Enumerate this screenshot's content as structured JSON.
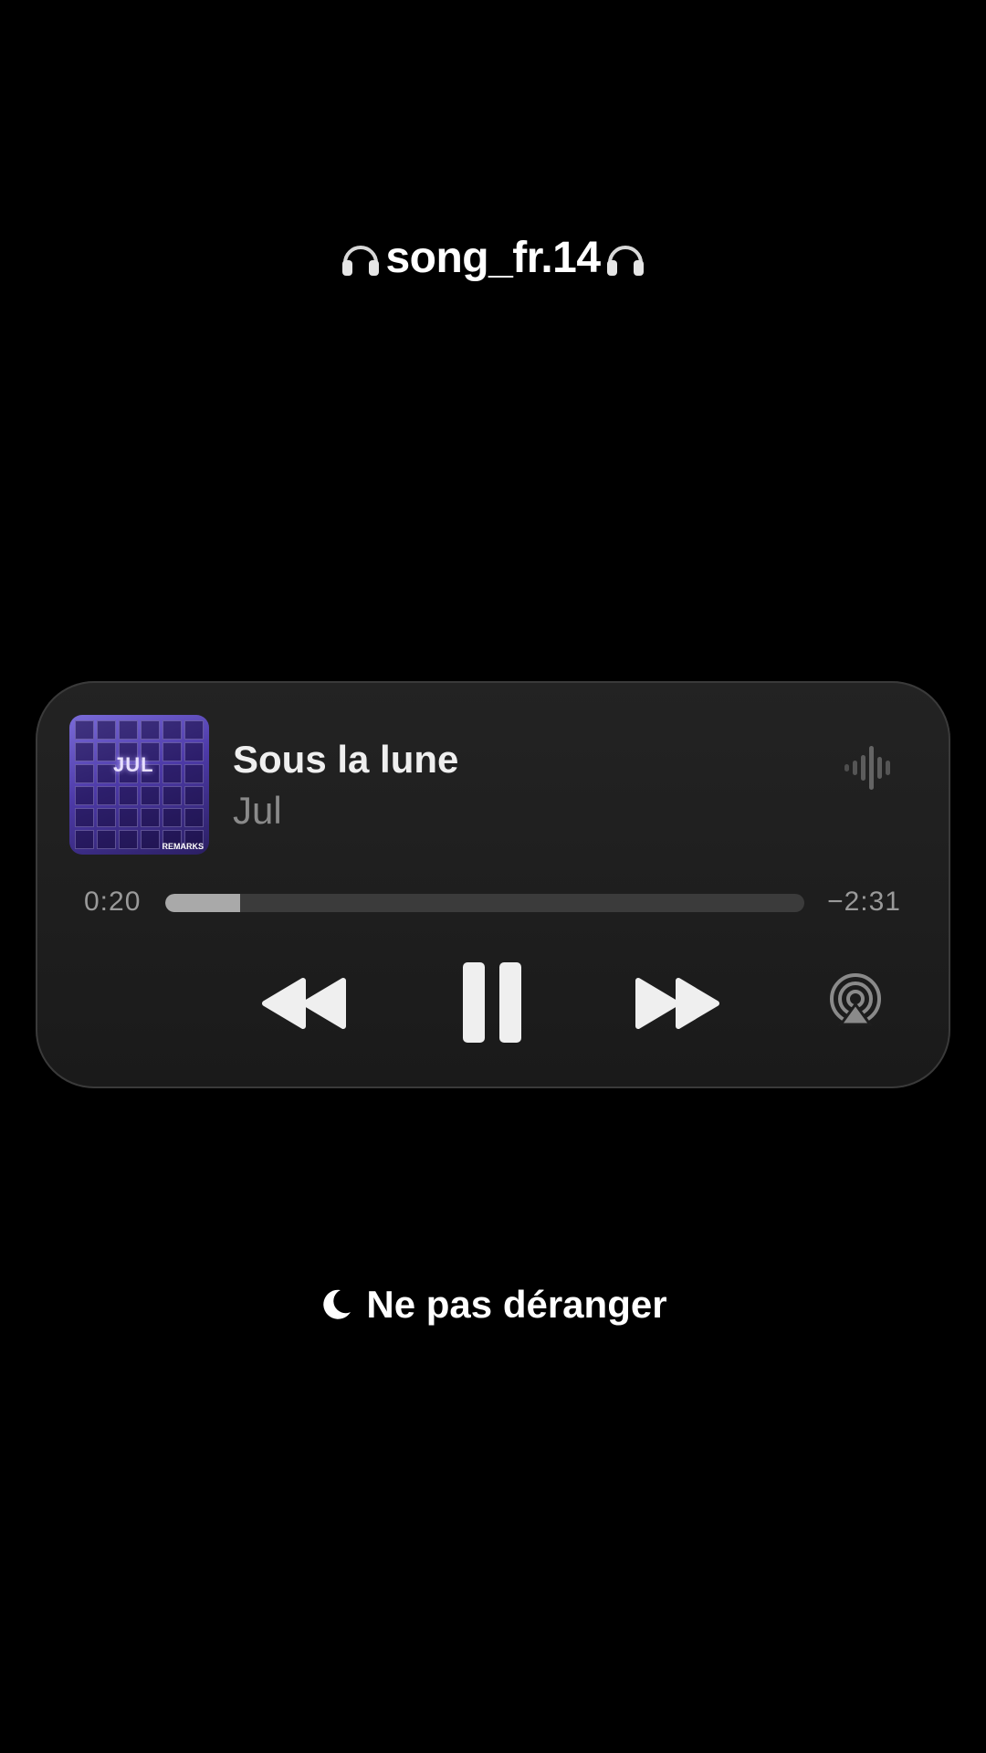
{
  "caption": {
    "text": "song_fr.14",
    "left_icon": "headphones-icon",
    "right_icon": "headphones-icon"
  },
  "player": {
    "artwork": {
      "title_text": "JUL",
      "mark_text": "REMARKS"
    },
    "track_title": "Sous la lune",
    "artist": "Jul",
    "waveform_icon": "waveform-icon",
    "time_elapsed": "0:20",
    "time_remaining": "−2:31",
    "progress": 0.117,
    "controls": {
      "rewind_icon": "rewind-icon",
      "pause_icon": "pause-icon",
      "forward_icon": "fast-forward-icon",
      "airplay_icon": "airplay-icon"
    }
  },
  "focus_mode": {
    "icon": "moon-icon",
    "label": "Ne pas déranger"
  },
  "colors": {
    "background": "#000000",
    "card": "#1e1e1e",
    "progress_fill": "#a9a9a9",
    "progress_track": "#3b3b3b",
    "secondary_text": "#8a8a8a"
  }
}
